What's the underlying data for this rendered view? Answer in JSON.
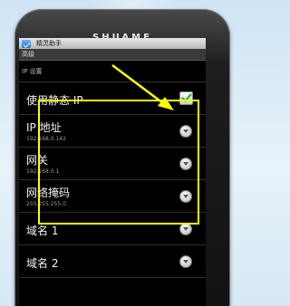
{
  "device": {
    "brand": "SHUAME"
  },
  "statusbar": {
    "app_name": "精灵助手"
  },
  "titlebar": {
    "title": "高级"
  },
  "section": {
    "header": "IP 设置"
  },
  "prefs": [
    {
      "title": "使用静态 IP",
      "summary": "",
      "control": "checkbox",
      "checked": true
    },
    {
      "title": "IP 地址",
      "summary": "192.168.0.142",
      "control": "dropdown"
    },
    {
      "title": "网关",
      "summary": "192.168.0.1",
      "control": "dropdown"
    },
    {
      "title": "网络掩码",
      "summary": "255.255.255.0",
      "control": "dropdown"
    },
    {
      "title": "域名 1",
      "summary": "",
      "control": "dropdown"
    },
    {
      "title": "域名 2",
      "summary": "",
      "control": "dropdown"
    }
  ],
  "colors": {
    "highlight": "#ffff00",
    "check": "#3ab53a",
    "screen_bg": "#000000"
  }
}
